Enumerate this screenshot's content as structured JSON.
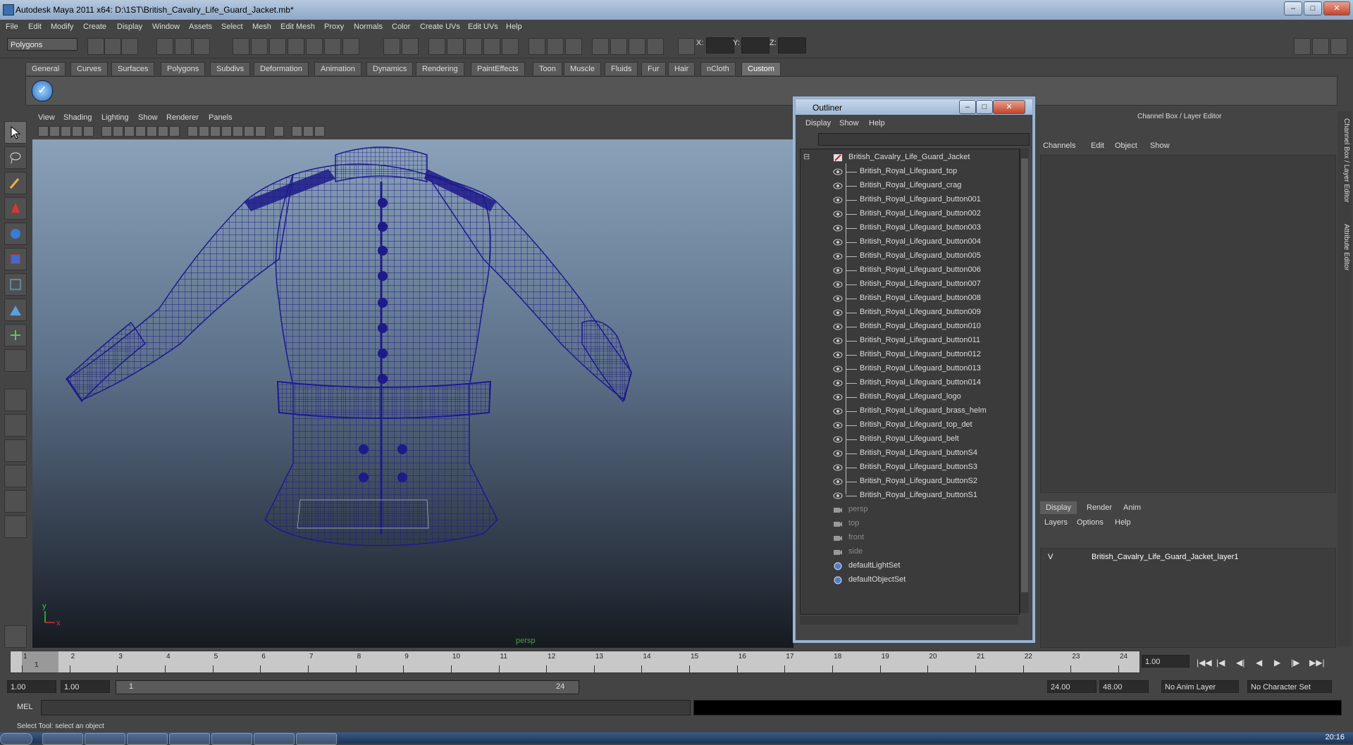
{
  "window": {
    "title": "Autodesk Maya 2011 x64: D:\\1ST\\British_Cavalry_Life_Guard_Jacket.mb*",
    "minimize": "–",
    "maximize": "□",
    "close": "✕"
  },
  "menubar": [
    "File",
    "Edit",
    "Modify",
    "Create",
    "Display",
    "Window",
    "Assets",
    "Select",
    "Mesh",
    "Edit Mesh",
    "Proxy",
    "Normals",
    "Color",
    "Create UVs",
    "Edit UVs",
    "Help"
  ],
  "statusline": {
    "mode": "Polygons",
    "x_label": "X:",
    "y_label": "Y:",
    "z_label": "Z:"
  },
  "shelf": {
    "tabs": [
      "General",
      "Curves",
      "Surfaces",
      "Polygons",
      "Subdivs",
      "Deformation",
      "Animation",
      "Dynamics",
      "Rendering",
      "PaintEffects",
      "Toon",
      "Muscle",
      "Fluids",
      "Fur",
      "Hair",
      "nCloth",
      "Custom"
    ],
    "active_tab": "Custom",
    "check_icon": "✓"
  },
  "viewport": {
    "menu": [
      "View",
      "Shading",
      "Lighting",
      "Show",
      "Renderer",
      "Panels"
    ],
    "camera_label": "persp",
    "axis_y": "y",
    "axis_x": "x"
  },
  "outliner": {
    "title": "Outliner",
    "menu": [
      "Display",
      "Show",
      "Help"
    ],
    "root": "British_Cavalry_Life_Guard_Jacket",
    "children": [
      "British_Royal_Lifeguard_top",
      "British_Royal_Lifeguard_crag",
      "British_Royal_Lifeguard_button001",
      "British_Royal_Lifeguard_button002",
      "British_Royal_Lifeguard_button003",
      "British_Royal_Lifeguard_button004",
      "British_Royal_Lifeguard_button005",
      "British_Royal_Lifeguard_button006",
      "British_Royal_Lifeguard_button007",
      "British_Royal_Lifeguard_button008",
      "British_Royal_Lifeguard_button009",
      "British_Royal_Lifeguard_button010",
      "British_Royal_Lifeguard_button011",
      "British_Royal_Lifeguard_button012",
      "British_Royal_Lifeguard_button013",
      "British_Royal_Lifeguard_button014",
      "British_Royal_Lifeguard_logo",
      "British_Royal_Lifeguard_brass_helm",
      "British_Royal_Lifeguard_top_det",
      "British_Royal_Lifeguard_belt",
      "British_Royal_Lifeguard_buttonS4",
      "British_Royal_Lifeguard_buttonS3",
      "British_Royal_Lifeguard_buttonS2",
      "British_Royal_Lifeguard_buttonS1"
    ],
    "cameras": [
      "persp",
      "top",
      "front",
      "side"
    ],
    "sets": [
      "defaultLightSet",
      "defaultObjectSet"
    ]
  },
  "channelbox": {
    "title": "Channel Box / Layer Editor",
    "menu": [
      "Channels",
      "Edit",
      "Object",
      "Show"
    ],
    "layer_tabs": [
      "Display",
      "Render",
      "Anim"
    ],
    "layer_menu": [
      "Layers",
      "Options",
      "Help"
    ],
    "layer_visible": "V",
    "layer_name": "British_Cavalry_Life_Guard_Jacket_layer1",
    "side_tabs": [
      "Channel Box / Layer Editor",
      "Attribute Editor"
    ]
  },
  "timeline": {
    "ticks": [
      "1",
      "2",
      "3",
      "4",
      "5",
      "6",
      "7",
      "8",
      "9",
      "10",
      "11",
      "12",
      "13",
      "14",
      "15",
      "16",
      "17",
      "18",
      "19",
      "20",
      "21",
      "22",
      "23",
      "24"
    ],
    "current_frame_marker": "1",
    "current_frame": "1.00"
  },
  "range": {
    "start_time": "1.00",
    "playback_start": "1.00",
    "range_start_label": "1",
    "range_end_label": "24",
    "playback_end": "24.00",
    "end_time": "48.00",
    "anim_layer": "No Anim Layer",
    "character_set": "No Character Set"
  },
  "command": {
    "label": "MEL"
  },
  "helpline": "Select Tool: select an object",
  "taskbar": {
    "clock": "20:16"
  }
}
